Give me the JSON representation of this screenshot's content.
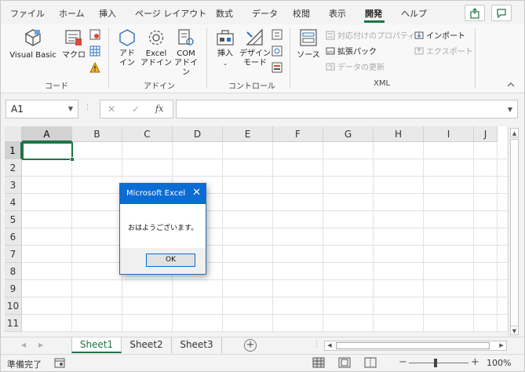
{
  "ribbon_tabs": [
    "ファイル",
    "ホーム",
    "挿入",
    "ページ レイアウト",
    "数式",
    "データ",
    "校閲",
    "表示",
    "開発",
    "ヘルプ"
  ],
  "active_tab": "開発",
  "groups": {
    "code": {
      "label": "コード",
      "visual_basic": "Visual Basic",
      "macro": "マクロ"
    },
    "addins": {
      "label": "アドイン",
      "addin_l1": "アド",
      "addin_l2": "イン",
      "excel_addin_l1": "Excel",
      "excel_addin_l2": "アドイン",
      "com_addin_l1": "COM",
      "com_addin_l2": "アドイン"
    },
    "controls": {
      "label": "コントロール",
      "insert": "挿入",
      "design_mode_l1": "デザイン",
      "design_mode_l2": "モード"
    },
    "xml": {
      "label": "XML",
      "source": "ソース",
      "map_properties": "対応付けのプロパティ",
      "expansion_packs": "拡張パック",
      "refresh_data": "データの更新",
      "import": "インポート",
      "export": "エクスポート"
    }
  },
  "formula_bar": {
    "name_box": "A1",
    "fx_label": "fx",
    "cancel_glyph": "✕",
    "enter_glyph": "✓",
    "content": ""
  },
  "columns": [
    "A",
    "B",
    "C",
    "D",
    "E",
    "F",
    "G",
    "H",
    "I",
    "J"
  ],
  "rows": [
    "1",
    "2",
    "3",
    "4",
    "5",
    "6",
    "7",
    "8",
    "9",
    "10",
    "11"
  ],
  "selected_cell": "A1",
  "sheets": [
    "Sheet1",
    "Sheet2",
    "Sheet3"
  ],
  "active_sheet": "Sheet1",
  "status": {
    "ready": "準備完了",
    "zoom": "100%",
    "zoom_minus": "−",
    "zoom_plus": "+"
  },
  "dialog": {
    "title": "Microsoft Excel",
    "message": "おはようございます。",
    "ok_label": "OK",
    "close_glyph": "✕"
  },
  "colors": {
    "accent": "#217346",
    "dialog_title": "#0b6cd4"
  }
}
